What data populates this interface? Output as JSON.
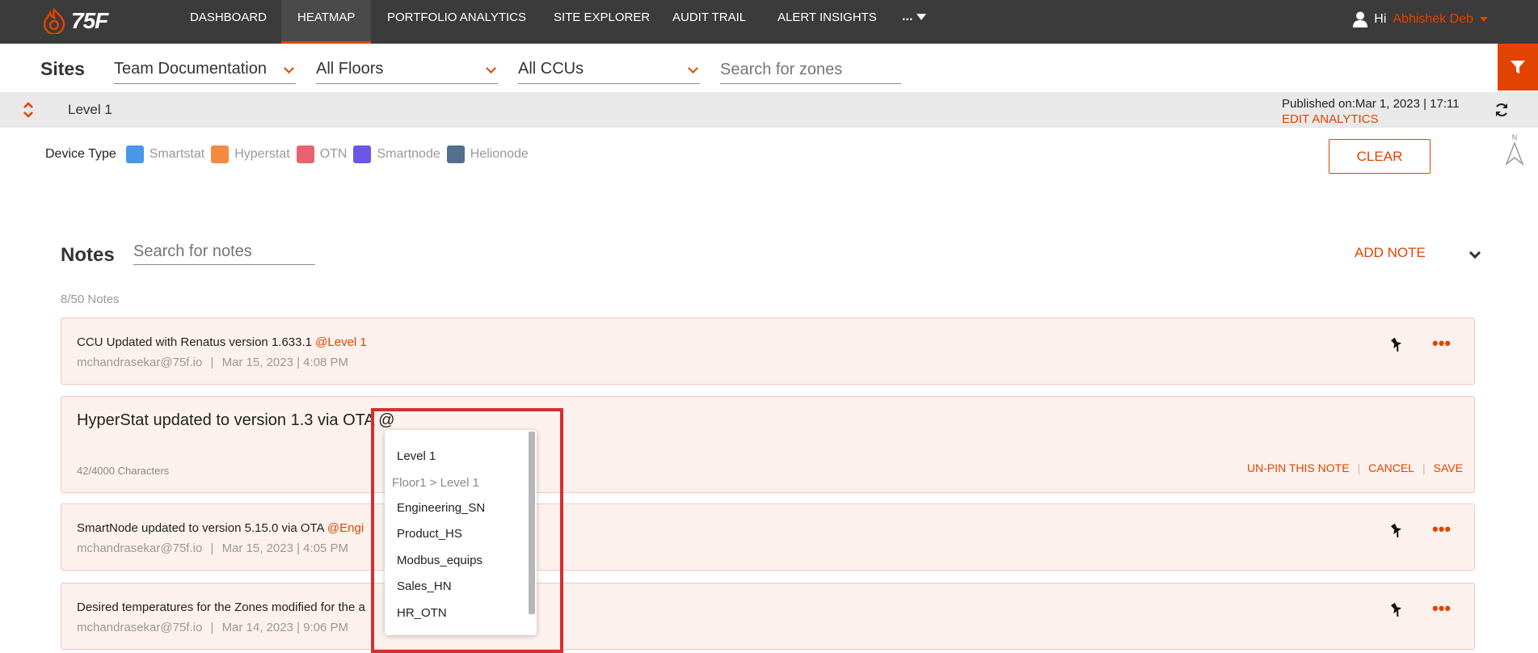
{
  "nav": {
    "logo_text": "75F",
    "items": [
      "DASHBOARD",
      "HEATMAP",
      "PORTFOLIO ANALYTICS",
      "SITE EXPLORER",
      "AUDIT TRAIL",
      "ALERT INSIGHTS"
    ],
    "active": "HEATMAP",
    "more_label": "...",
    "greeting": "Hi",
    "user_name": "Abhishek Deb",
    "accent_color": "#e24301"
  },
  "sites": {
    "label": "Sites",
    "site_select": "Team Documentation",
    "floor_select": "All Floors",
    "ccu_select": "All CCUs",
    "zone_search_placeholder": "Search for zones"
  },
  "level": {
    "name": "Level 1",
    "published": "Published on:Mar 1, 2023 | 17:11",
    "edit_analytics": "EDIT ANALYTICS"
  },
  "device_type": {
    "label": "Device Type",
    "items": [
      {
        "name": "Smartstat",
        "color": "#4a97e8"
      },
      {
        "name": "Hyperstat",
        "color": "#f5893e"
      },
      {
        "name": "OTN",
        "color": "#e8636f"
      },
      {
        "name": "Smartnode",
        "color": "#6b57e6"
      },
      {
        "name": "Helionode",
        "color": "#53708d"
      }
    ],
    "clear_label": "CLEAR",
    "north_label": "N"
  },
  "notes": {
    "title": "Notes",
    "search_placeholder": "Search for notes",
    "add_note": "ADD NOTE",
    "count": "8/50 Notes",
    "cards": [
      {
        "text": "CCU Updated with Renatus version 1.633.1 ",
        "mention": "@Level 1",
        "author": "mchandrasekar@75f.io",
        "date": "Mar 15, 2023 | 4:08 PM"
      },
      {
        "text": "SmartNode updated to version 5.15.0  via OTA ",
        "mention": "@Engi",
        "author": "mchandrasekar@75f.io",
        "date": "Mar 15, 2023 | 4:05 PM"
      },
      {
        "text": "Desired temperatures for the Zones modified for the a",
        "mention": "",
        "author": "mchandrasekar@75f.io",
        "date": "Mar 14, 2023 | 9:06 PM"
      }
    ],
    "editing": {
      "text": "HyperStat updated to version 1.3 via OTA @",
      "char_count": "42/4000 Characters",
      "unpin": "UN-PIN THIS NOTE",
      "cancel": "CANCEL",
      "save": "SAVE"
    }
  },
  "mention_dropdown": {
    "options": [
      "Level 1",
      "Floor1 > Level 1",
      "Engineering_SN",
      "Product_HS",
      "Modbus_equips",
      "Sales_HN",
      "HR_OTN"
    ]
  }
}
